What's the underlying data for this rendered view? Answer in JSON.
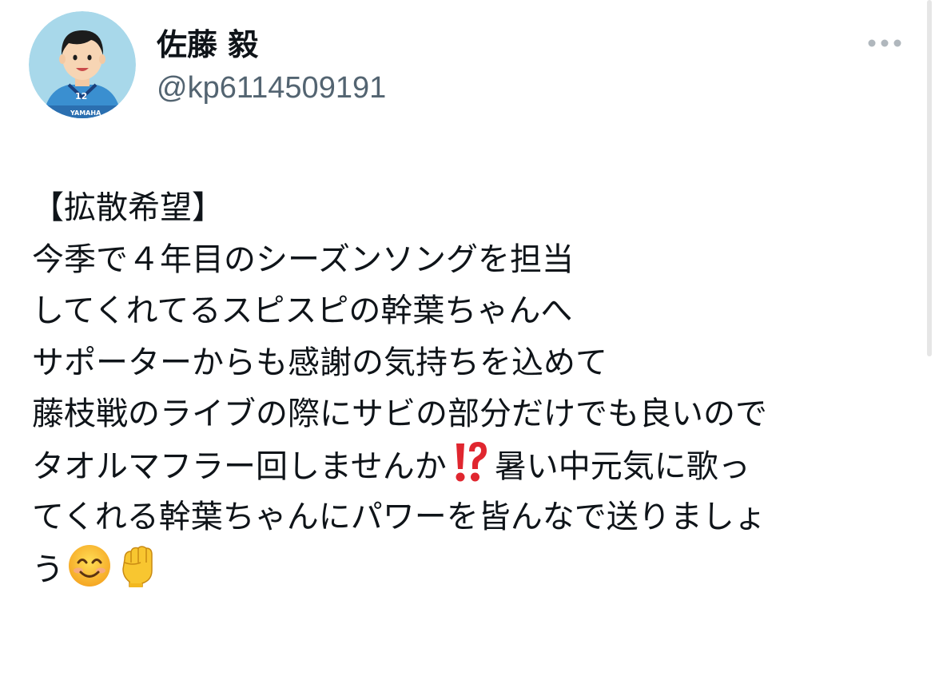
{
  "tweet": {
    "author": {
      "display_name": "佐藤 毅",
      "handle": "@kp6114509191",
      "avatar_icon": "avatar-cartoon-soccer-player-icon",
      "avatar_jersey_number": "12",
      "avatar_jersey_text": "YAMAHA"
    },
    "more_icon": "more-horizontal-icon",
    "body_lines": [
      "【拡散希望】",
      "今季で４年目のシーズンソングを担当",
      "してくれてるスピスピの幹葉ちゃんへ",
      "サポーターからも感謝の気持ちを込めて",
      "藤枝戦のライブの際にサビの部分だけでも良いので"
    ],
    "line6_before_emoji": "タオルマフラー回しませんか",
    "line6_emoji": "exclamation-question-mark-emoji",
    "line6_after_emoji": "暑い中元気に歌っ",
    "line7": "てくれる幹葉ちゃんにパワーを皆んなで送りましょ",
    "line8_text": "う",
    "line8_emojis": [
      "smiling-face-emoji",
      "raised-fist-emoji"
    ]
  },
  "colors": {
    "text": "#0f1419",
    "secondary_text": "#536471",
    "avatar_bg": "#9fd3e8",
    "jersey": "#3a8fd0",
    "emoji_red": "#e0262f",
    "emoji_yellow": "#f8c630"
  }
}
